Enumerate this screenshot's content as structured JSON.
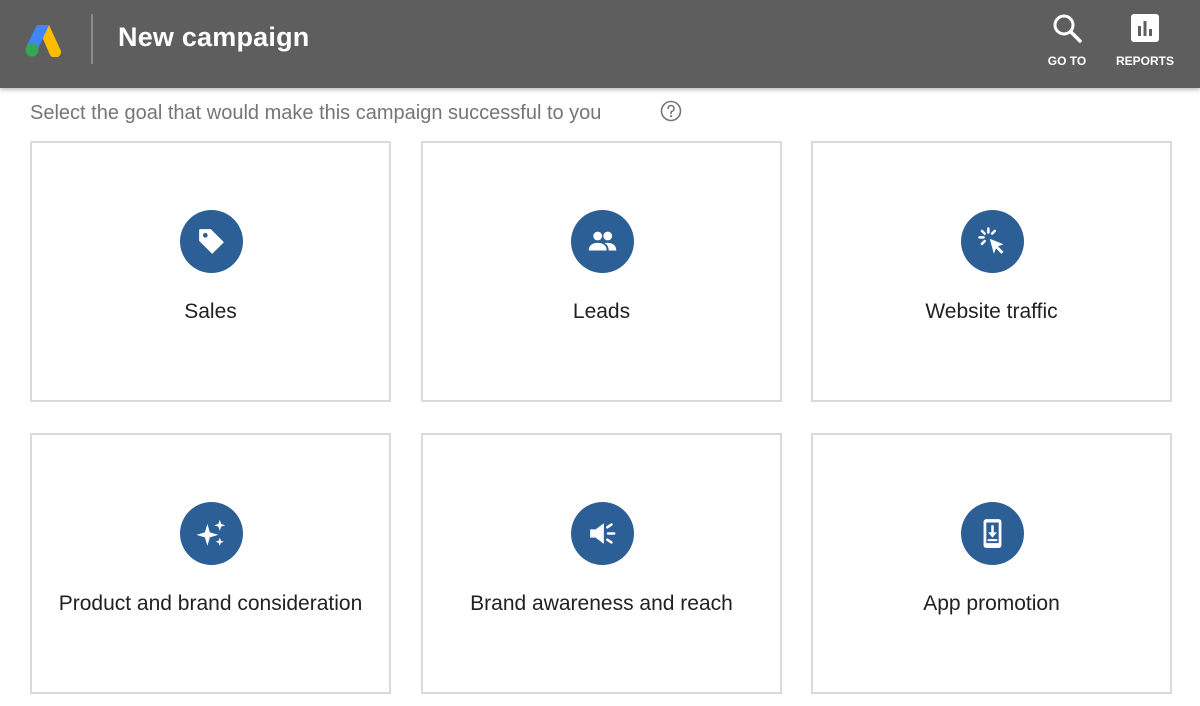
{
  "header": {
    "title": "New campaign",
    "actions": [
      {
        "label": "GO TO",
        "icon": "search-icon"
      },
      {
        "label": "REPORTS",
        "icon": "reports-icon"
      }
    ],
    "background": "#5e5e5e"
  },
  "prompt": {
    "text": "Select the goal that would make this campaign successful to you",
    "help_icon": "help-circle-icon"
  },
  "goals": [
    {
      "label": "Sales",
      "icon": "tag-icon"
    },
    {
      "label": "Leads",
      "icon": "people-icon"
    },
    {
      "label": "Website traffic",
      "icon": "cursor-click-icon"
    },
    {
      "label": "Product and brand consideration",
      "icon": "sparkle-icon"
    },
    {
      "label": "Brand awareness and reach",
      "icon": "megaphone-icon"
    },
    {
      "label": "App promotion",
      "icon": "phone-download-icon"
    }
  ],
  "colors": {
    "accent": "#2c5f96",
    "card_border": "#dadada",
    "prompt_text": "#757575"
  }
}
